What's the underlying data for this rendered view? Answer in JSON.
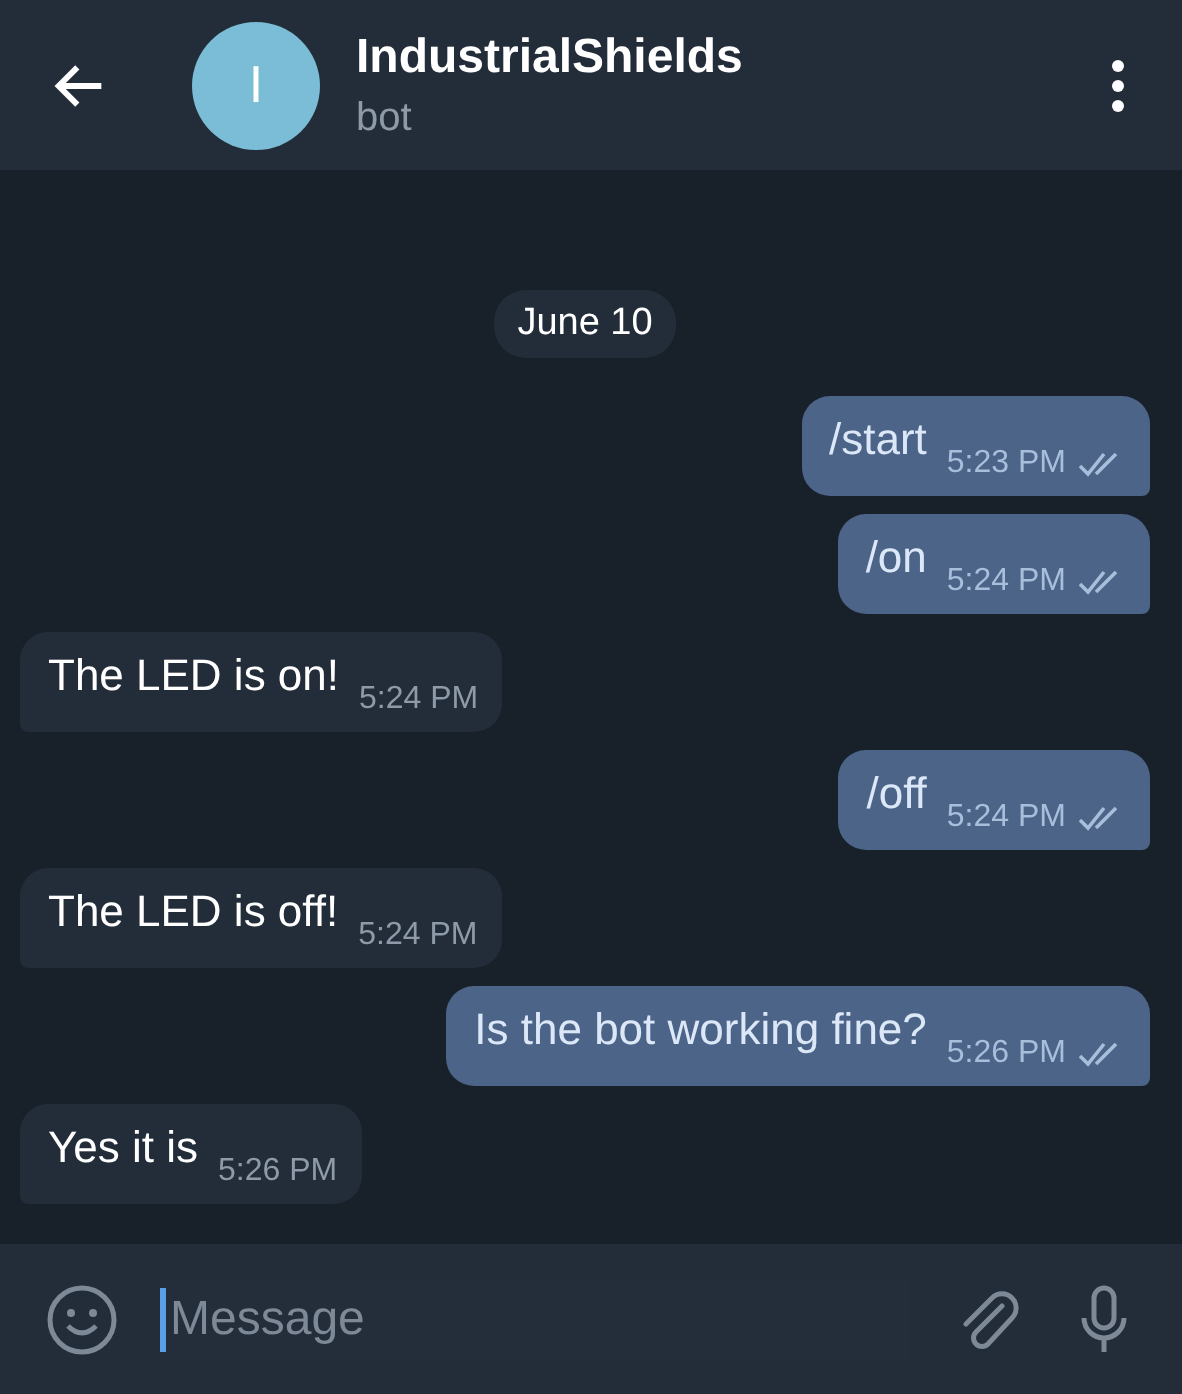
{
  "header": {
    "avatar_letter": "I",
    "title": "IndustrialShields",
    "subtitle": "bot"
  },
  "date_chip": "June 10",
  "messages": [
    {
      "kind": "out",
      "text": "/start",
      "time": "5:23 PM",
      "read": true
    },
    {
      "kind": "out",
      "text": "/on",
      "time": "5:24 PM",
      "read": true
    },
    {
      "kind": "in",
      "text": "The LED is on!",
      "time": "5:24 PM"
    },
    {
      "kind": "out",
      "text": "/off",
      "time": "5:24 PM",
      "read": true
    },
    {
      "kind": "in",
      "text": "The LED is off!",
      "time": "5:24 PM"
    },
    {
      "kind": "out",
      "text": "Is the bot working fine?",
      "time": "5:26 PM",
      "read": true
    },
    {
      "kind": "in",
      "text": "Yes it is",
      "time": "5:26 PM"
    }
  ],
  "composer": {
    "placeholder": "Message"
  }
}
